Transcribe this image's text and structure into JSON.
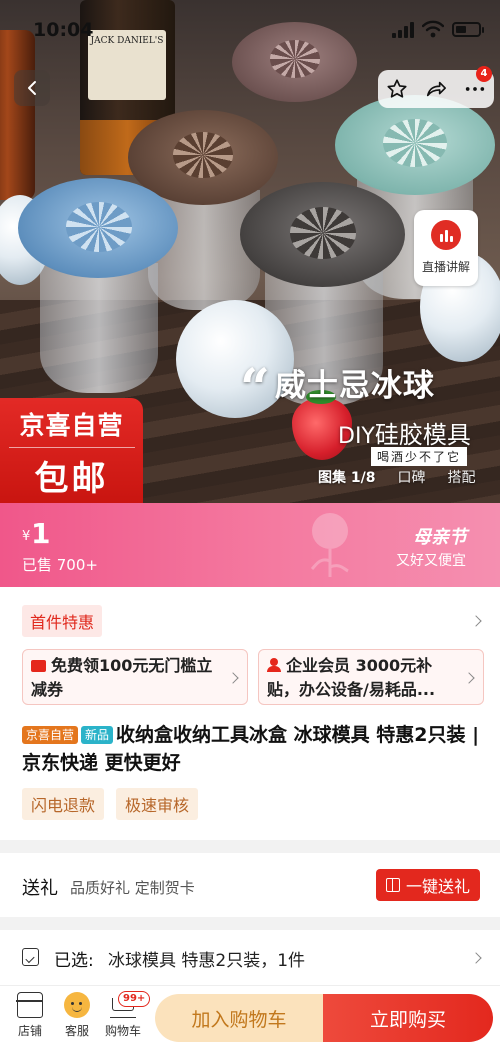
{
  "status_bar": {
    "time": "10:04"
  },
  "hero": {
    "bottle_label": "JACK DANIEL'S",
    "headline": "威士忌冰球",
    "subhead_prefix": "DIY",
    "subhead": "硅胶模具",
    "tagline": "喝酒少不了它",
    "promo_line1": "京喜自营",
    "promo_line2": "包邮",
    "live_label": "直播讲解",
    "notification_count": "4",
    "gallery_tabs": [
      "图集 1/8",
      "口碑",
      "搭配"
    ]
  },
  "price_banner": {
    "currency": "¥",
    "price": "1",
    "sold": "已售 700+",
    "festival": "母亲节",
    "festival_sub": "又好又便宜"
  },
  "info": {
    "first_deal": "首件特惠",
    "coupons": [
      {
        "text": "免费领100元无门槛立减券"
      },
      {
        "text": "企业会员 3000元补贴，办公设备/易耗品..."
      }
    ],
    "tags": [
      "京喜自营",
      "新品"
    ],
    "title": "收纳盒收纳工具冰盒 冰球模具 特惠2只装 | 京东快递 更快更好",
    "services": [
      "闪电退款",
      "极速审核"
    ]
  },
  "gift": {
    "label": "送礼",
    "sub": "品质好礼  定制贺卡",
    "button": "一键送礼"
  },
  "selected": {
    "label": "已选:",
    "value": "冰球模具 特惠2只装，1件"
  },
  "bottom_bar": {
    "store": "店铺",
    "service": "客服",
    "cart": "购物车",
    "cart_badge": "99+",
    "add_cart": "加入购物车",
    "buy_now": "立即购买"
  }
}
